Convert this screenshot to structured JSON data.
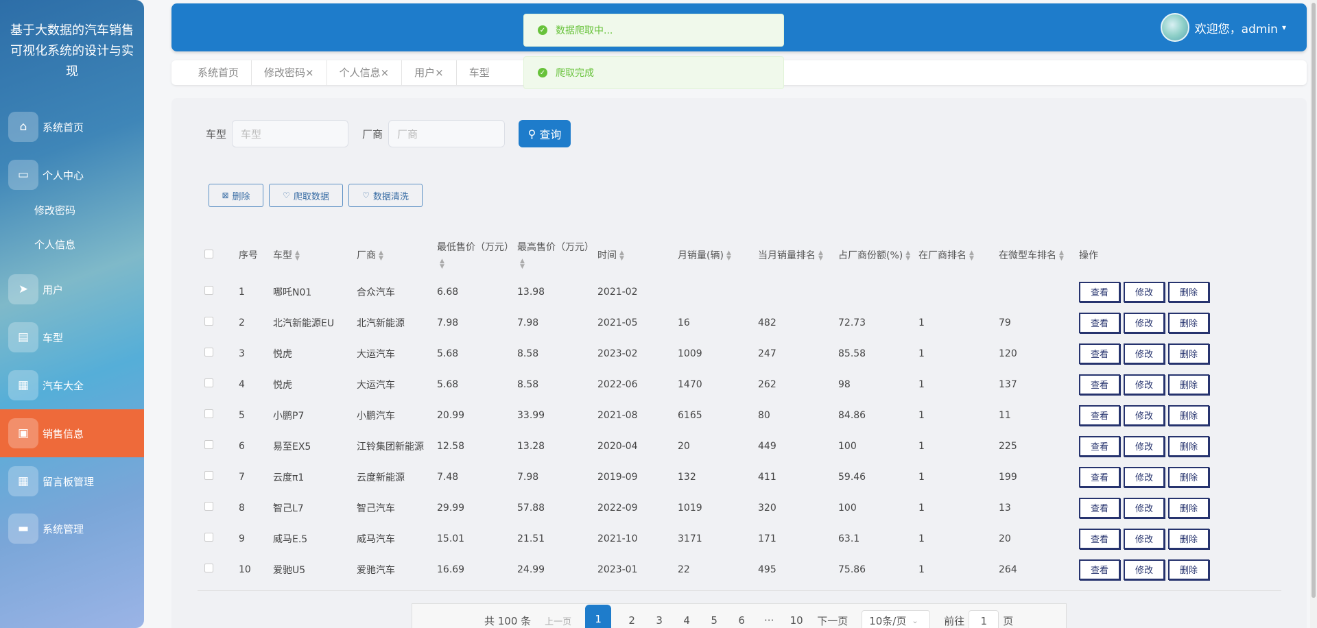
{
  "app": {
    "title": "基于大数据的汽车销售可视化系统的设计与实现"
  },
  "sidebar": {
    "items": [
      {
        "label": "系统首页",
        "icon": "home-icon"
      },
      {
        "label": "个人中心",
        "icon": "profile-icon"
      },
      {
        "label": "修改密码"
      },
      {
        "label": "个人信息"
      },
      {
        "label": "用户",
        "icon": "send-icon"
      },
      {
        "label": "车型",
        "icon": "chart-icon"
      },
      {
        "label": "汽车大全",
        "icon": "grid-icon"
      },
      {
        "label": "销售信息",
        "icon": "clipboard-icon",
        "active": true
      },
      {
        "label": "留言板管理",
        "icon": "grid-icon"
      },
      {
        "label": "系统管理",
        "icon": "monitor-icon"
      }
    ]
  },
  "header": {
    "welcome": "欢迎您，admin",
    "caret": "▾"
  },
  "toasts": [
    {
      "text": "数据爬取中..."
    },
    {
      "text": "爬取完成"
    }
  ],
  "tabs": [
    "系统首页",
    "修改密码×",
    "个人信息×",
    "用户×",
    "车型"
  ],
  "filter": {
    "model_label": "车型",
    "model_placeholder": "车型",
    "maker_label": "厂商",
    "maker_placeholder": "厂商",
    "search_label": "查询"
  },
  "toolbar": {
    "delete": "删除",
    "crawl": "爬取数据",
    "clean": "数据清洗"
  },
  "table": {
    "headers": [
      "序号",
      "车型",
      "厂商",
      "最低售价（万元）",
      "最高售价（万元）",
      "时间",
      "月销量(辆)",
      "当月销量排名",
      "占厂商份额(%)",
      "在厂商排名",
      "在微型车排名",
      "操作"
    ],
    "rows": [
      [
        "1",
        "哪吒N01",
        "合众汽车",
        "6.68",
        "13.98",
        "2021-02",
        "",
        "",
        "",
        "",
        ""
      ],
      [
        "2",
        "北汽新能源EU",
        "北汽新能源",
        "7.98",
        "7.98",
        "2021-05",
        "16",
        "482",
        "72.73",
        "1",
        "79"
      ],
      [
        "3",
        "悦虎",
        "大运汽车",
        "5.68",
        "8.58",
        "2023-02",
        "1009",
        "247",
        "85.58",
        "1",
        "120"
      ],
      [
        "4",
        "悦虎",
        "大运汽车",
        "5.68",
        "8.58",
        "2022-06",
        "1470",
        "262",
        "98",
        "1",
        "137"
      ],
      [
        "5",
        "小鹏P7",
        "小鹏汽车",
        "20.99",
        "33.99",
        "2021-08",
        "6165",
        "80",
        "84.86",
        "1",
        "11"
      ],
      [
        "6",
        "易至EX5",
        "江铃集团新能源",
        "12.58",
        "13.28",
        "2020-04",
        "20",
        "449",
        "100",
        "1",
        "225"
      ],
      [
        "7",
        "云度π1",
        "云度新能源",
        "7.48",
        "7.98",
        "2019-09",
        "132",
        "411",
        "59.46",
        "1",
        "199"
      ],
      [
        "8",
        "智己L7",
        "智己汽车",
        "29.99",
        "57.88",
        "2022-09",
        "1019",
        "320",
        "100",
        "1",
        "13"
      ],
      [
        "9",
        "威马E.5",
        "威马汽车",
        "15.01",
        "21.51",
        "2021-10",
        "3171",
        "171",
        "63.1",
        "1",
        "20"
      ],
      [
        "10",
        "爱驰U5",
        "爱驰汽车",
        "16.69",
        "24.99",
        "2023-01",
        "22",
        "495",
        "75.86",
        "1",
        "264"
      ]
    ],
    "row_actions": {
      "view": "查看",
      "edit": "修改",
      "delete": "删除"
    }
  },
  "pagination": {
    "total": "共 100 条",
    "prev": "上一页",
    "pages": [
      "1",
      "2",
      "3",
      "4",
      "5",
      "6"
    ],
    "ellipsis": "···",
    "last": "10",
    "next": "下一页",
    "page_size": "10条/页",
    "goto_label": "前往",
    "goto_value": "1",
    "goto_suffix": "页"
  }
}
